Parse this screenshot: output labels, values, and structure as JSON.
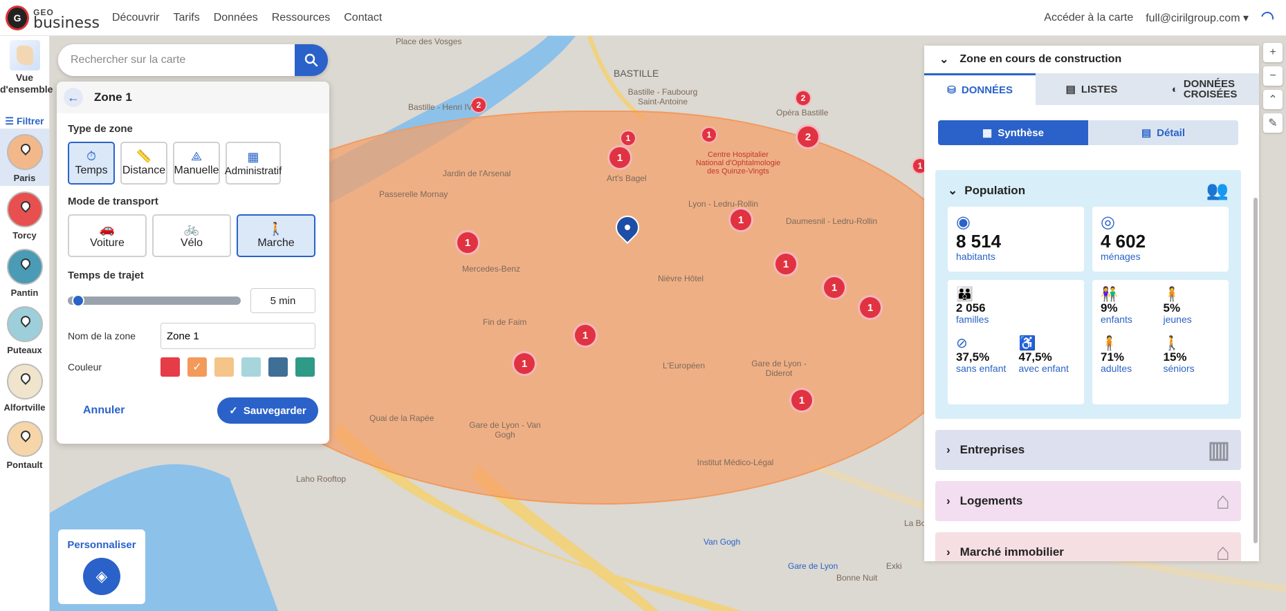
{
  "nav": {
    "logo_geo": "GEO",
    "logo_business": "business",
    "logo_mark": "G",
    "links": [
      "Découvrir",
      "Tarifs",
      "Données",
      "Ressources",
      "Contact"
    ],
    "map_link": "Accéder à la carte",
    "user": "full@cirilgroup.com ▾"
  },
  "sidebar": {
    "overview_label_1": "Vue",
    "overview_label_2": "d'ensemble",
    "filter_label": "Filtrer",
    "zones": [
      {
        "label": "Paris",
        "active": true,
        "color": "#f3b889"
      },
      {
        "label": "Torcy",
        "active": false,
        "color": "#e85050"
      },
      {
        "label": "Pantin",
        "active": false,
        "color": "#4a9bb5"
      },
      {
        "label": "Puteaux",
        "active": false,
        "color": "#9ccfda"
      },
      {
        "label": "Alfortville",
        "active": false,
        "color": "#f0e4cc"
      },
      {
        "label": "Pontault",
        "active": false,
        "color": "#f6d6a8"
      }
    ]
  },
  "search": {
    "placeholder": "Rechercher sur la carte"
  },
  "zone_panel": {
    "title": "Zone 1",
    "zone_type_title": "Type de zone",
    "zone_types": [
      {
        "label": "Temps",
        "icon": "⏱",
        "active": true
      },
      {
        "label": "Distance",
        "icon": "📏",
        "active": false
      },
      {
        "label": "Manuelle",
        "icon": "⟁",
        "active": false
      },
      {
        "label": "Administratif",
        "icon": "▦",
        "active": false
      }
    ],
    "transport_title": "Mode de transport",
    "transports": [
      {
        "label": "Voiture",
        "icon": "🚗",
        "active": false
      },
      {
        "label": "Vélo",
        "icon": "🚲",
        "active": false
      },
      {
        "label": "Marche",
        "icon": "🚶",
        "active": true
      }
    ],
    "travel_time_title": "Temps de trajet",
    "travel_time_value": "5 min",
    "name_label": "Nom de la zone",
    "name_value": "Zone 1",
    "color_label": "Couleur",
    "colors": [
      "#e63c48",
      "#f39a5a",
      "#f4c488",
      "#a6d6dc",
      "#3f6f96",
      "#2f9a86"
    ],
    "selected_color_index": 1,
    "cancel_label": "Annuler",
    "save_label": "Sauvegarder"
  },
  "personnaliser": {
    "label": "Personnaliser"
  },
  "map": {
    "labels": [
      {
        "text": "BASTILLE",
        "big": true
      },
      {
        "text": "Place des Vosges"
      },
      {
        "text": "Bastille - Faubourg Saint-Antoine"
      },
      {
        "text": "Bastille - Henri IV"
      },
      {
        "text": "Jardin de l'Arsenal"
      },
      {
        "text": "Passerelle Mornay"
      },
      {
        "text": "Centre Hospitalier National d'Ophtalmologie des Quinze-Vingts"
      },
      {
        "text": "Lyon - Ledru-Rollin"
      },
      {
        "text": "Daumesnil - Ledru-Rollin"
      },
      {
        "text": "Mercedes-Benz"
      },
      {
        "text": "Nièvre Hôtel"
      },
      {
        "text": "Fin de Faim"
      },
      {
        "text": "Gare de Lyon - Diderot"
      },
      {
        "text": "L'Européen"
      },
      {
        "text": "Quai de la Rapée"
      },
      {
        "text": "Gare de Lyon - Van Gogh"
      },
      {
        "text": "Institut Médico-Légal"
      },
      {
        "text": "Laho Rooftop"
      },
      {
        "text": "Van Gogh",
        "blue": true
      },
      {
        "text": "Gare de Lyon",
        "blue": true
      },
      {
        "text": "Exki"
      },
      {
        "text": "Bonne Nuit"
      },
      {
        "text": "La Boule Blanche"
      },
      {
        "text": "Opéra Bastille"
      },
      {
        "text": "Art's Bagel"
      }
    ],
    "markers": [
      {
        "n": "2"
      },
      {
        "n": "1"
      },
      {
        "n": "2"
      },
      {
        "n": "1"
      },
      {
        "n": "1"
      },
      {
        "n": "1"
      },
      {
        "n": "1"
      },
      {
        "n": "1"
      },
      {
        "n": "1"
      },
      {
        "n": "1"
      },
      {
        "n": "1"
      },
      {
        "n": "1"
      },
      {
        "n": "1"
      },
      {
        "n": "1"
      },
      {
        "n": "2"
      }
    ]
  },
  "right_panel": {
    "title": "Zone en cours de construction",
    "tabs": [
      {
        "label": "DONNÉES",
        "active": true
      },
      {
        "label": "LISTES",
        "active": false
      },
      {
        "label": "DONNÉES CROISÉES",
        "active": false
      }
    ],
    "synthese_label": "Synthèse",
    "detail_label": "Détail",
    "population": {
      "title": "Population",
      "habitants_value": "8 514",
      "habitants_label": "habitants",
      "menages_value": "4 602",
      "menages_label": "ménages",
      "familles_value": "2 056",
      "familles_label": "familles",
      "sans_enfant_value": "37,5%",
      "sans_enfant_label": "sans enfant",
      "avec_enfant_value": "47,5%",
      "avec_enfant_label": "avec enfant",
      "enfants_value": "9%",
      "enfants_label": "enfants",
      "jeunes_value": "5%",
      "jeunes_label": "jeunes",
      "adultes_value": "71%",
      "adultes_label": "adultes",
      "seniors_value": "15%",
      "seniors_label": "séniors"
    },
    "sections": [
      {
        "title": "Entreprises",
        "color": "#dde0ef"
      },
      {
        "title": "Logements",
        "color": "#f2def0"
      },
      {
        "title": "Marché immobilier",
        "color": "#f6dfe3"
      }
    ]
  }
}
